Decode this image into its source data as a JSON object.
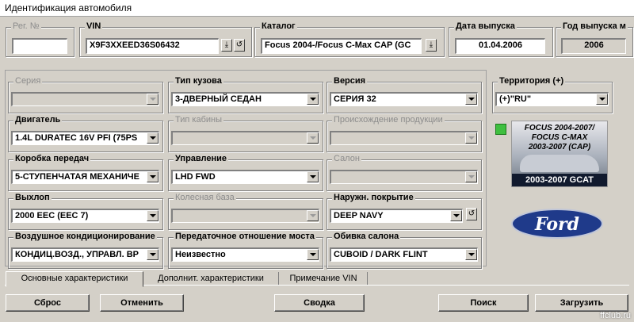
{
  "window": {
    "title": "Идентификация автомобиля"
  },
  "header": {
    "reg_no": {
      "label": "Рег. №",
      "value": ""
    },
    "vin": {
      "label": "VIN",
      "value": "X9F3XXEED36S06432"
    },
    "catalog": {
      "label": "Каталог",
      "value": "Focus 2004-/Focus C-Max CAP (GC"
    },
    "release_date": {
      "label": "Дата выпуска",
      "value": "01.04.2006"
    },
    "release_year": {
      "label": "Год выпуска м",
      "value": "2006"
    }
  },
  "fields": {
    "series": {
      "label": "Серия",
      "value": ""
    },
    "body_type": {
      "label": "Тип кузова",
      "value": "3-ДВЕРНЫЙ СЕДАН"
    },
    "version": {
      "label": "Версия",
      "value": "СЕРИЯ 32"
    },
    "territory": {
      "label": "Территория (+)",
      "value": "(+)\"RU\""
    },
    "engine": {
      "label": "Двигатель",
      "value": "1.4L DURATEC 16V PFI (75PS"
    },
    "cab_type": {
      "label": "Тип кабины",
      "value": ""
    },
    "origin": {
      "label": "Происхождение продукции",
      "value": ""
    },
    "gearbox": {
      "label": "Коробка передач",
      "value": "5-СТУПЕНЧАТАЯ МЕХАНИЧЕ"
    },
    "steering": {
      "label": "Управление",
      "value": "LHD FWD"
    },
    "interior": {
      "label": "Салон",
      "value": ""
    },
    "exhaust": {
      "label": "Выхлоп",
      "value": "2000 EEC (EEC 7)"
    },
    "wheelbase": {
      "label": "Колесная база",
      "value": ""
    },
    "paint": {
      "label": "Наружн. покрытие",
      "value": "DEEP NAVY"
    },
    "ac": {
      "label": "Воздушное кондиционирование",
      "value": "КОНДИЦ.ВОЗД., УПРАВЛ. ВР"
    },
    "gear_ratio": {
      "label": "Передаточное отношение моста",
      "value": "Неизвестно"
    },
    "upholstery": {
      "label": "Обивка салона",
      "value": "CUBOID / DARK FLINT"
    }
  },
  "promo": {
    "lines": [
      "FOCUS 2004-2007/",
      "FOCUS C-MAX",
      "2003-2007 (CAP)"
    ],
    "bar": "2003-2007 GCAT"
  },
  "logo": {
    "text": "Ford"
  },
  "tabs": [
    "Основные характеристики",
    "Дополнит. характеристики",
    "Примечание VIN"
  ],
  "buttons": {
    "reset": "Сброс",
    "cancel": "Отменить",
    "summary": "Сводка",
    "search": "Поиск",
    "load": "Загрузить"
  },
  "watermark": "ffclub.ru",
  "colors": {
    "window_bg": "#d4d0c8",
    "logo_blue": "#1f3a8a"
  }
}
